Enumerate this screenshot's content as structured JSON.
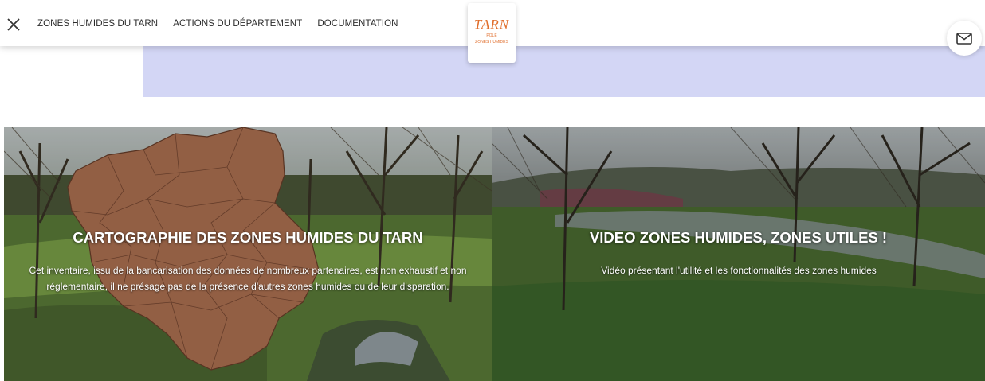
{
  "header": {
    "close_icon": "close-icon",
    "nav": [
      {
        "label": "ZONES HUMIDES DU TARN"
      },
      {
        "label": "ACTIONS DU DÉPARTEMENT"
      },
      {
        "label": "DOCUMENTATION"
      }
    ],
    "logo": {
      "main": "TARN",
      "line1": "PÔLE",
      "line2": "ZONES HUMIDES"
    },
    "mail_icon": "mail-icon"
  },
  "colors": {
    "logo_orange": "#e06e2c",
    "band_lavender": "#d3d6f5",
    "map_fill": "#b37454"
  },
  "cards": [
    {
      "title": "CARTOGRAPHIE DES ZONES HUMIDES DU TARN",
      "description": "Cet inventaire, issu de la bancarisation des données de nombreux partenaires, est non exhaustif et non réglementaire, il ne présage pas de la présence d'autres zones humides ou de leur disparation."
    },
    {
      "title": "VIDEO ZONES HUMIDES, ZONES UTILES !",
      "description": "Vidéo présentant l'utilité et les fonctionnalités des zones humides"
    }
  ]
}
